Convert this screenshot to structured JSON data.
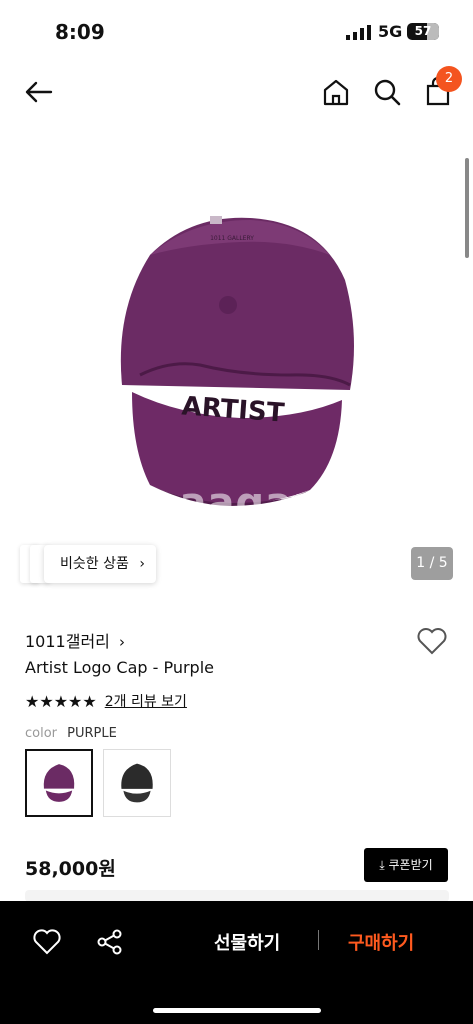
{
  "status_bar": {
    "time": "8:09",
    "network": "5G",
    "battery": "57"
  },
  "nav": {
    "cart_count": "2"
  },
  "gallery": {
    "watermark": "naagani",
    "similar_label": "비슷한 상품",
    "pager": "1 / 5"
  },
  "product": {
    "brand": "1011갤러리",
    "name": "Artist Logo Cap - Purple",
    "stars": "★★★★★",
    "rating": 5,
    "review_link": "2개 리뷰 보기",
    "color_key": "color",
    "color_value": "PURPLE",
    "price": "58,000원",
    "coupon_label": "쿠폰받기",
    "hat_text": "ARTIST"
  },
  "bottom_bar": {
    "gift_label": "선물하기",
    "buy_label": "구매하기"
  },
  "colors": {
    "accent": "#f4541f",
    "buy": "#ff5a1f",
    "cap_purple": "#6a2a63"
  }
}
